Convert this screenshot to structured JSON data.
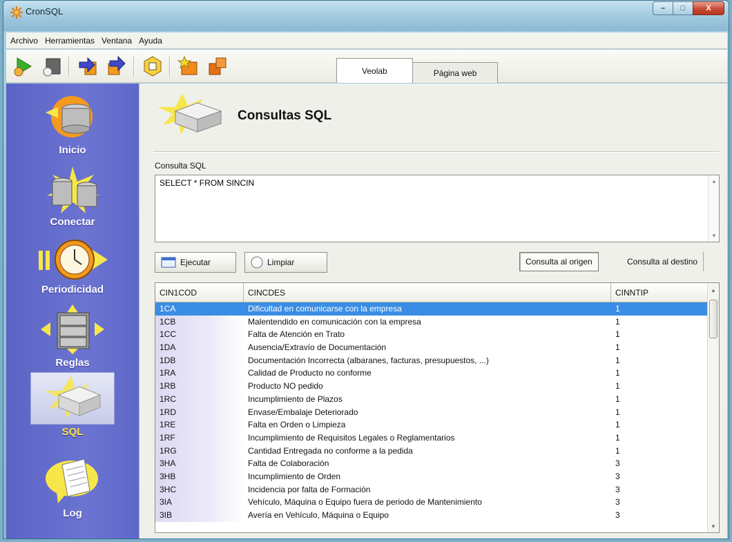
{
  "window": {
    "title": "CronSQL",
    "minimize": "–",
    "maximize": "□",
    "close": "X"
  },
  "menu": [
    "Archivo",
    "Herramientas",
    "Ventana",
    "Ayuda"
  ],
  "tabs": [
    {
      "label": "Veolab",
      "active": true
    },
    {
      "label": "Página web",
      "active": false
    }
  ],
  "sidebar": {
    "items": [
      {
        "label": "Inicio",
        "icon": "database-start-icon"
      },
      {
        "label": "Conectar",
        "icon": "database-connect-icon"
      },
      {
        "label": "Periodicidad",
        "icon": "clock-icon"
      },
      {
        "label": "Reglas",
        "icon": "filing-cabinet-icon"
      },
      {
        "label": "SQL",
        "icon": "sql-block-icon",
        "active": true
      },
      {
        "label": "Log",
        "icon": "log-document-icon"
      }
    ]
  },
  "page": {
    "title": "Consultas SQL",
    "query_label": "Consulta SQL",
    "query_value": "SELECT * FROM SINCIN"
  },
  "actions": {
    "execute": "Ejecutar",
    "clear": "Limpiar",
    "origin": "Consulta al origen",
    "destination": "Consulta al destino"
  },
  "grid": {
    "columns": [
      "CIN1COD",
      "CINCDES",
      "CINNTIP"
    ],
    "rows": [
      [
        "1CA",
        "Dificultad en comunicarse con la empresa",
        "1"
      ],
      [
        "1CB",
        "Malentendido en comunicación con la empresa",
        "1"
      ],
      [
        "1CC",
        "Falta de Atención en Trato",
        "1"
      ],
      [
        "1DA",
        "Ausencia/Extravío de Documentación",
        "1"
      ],
      [
        "1DB",
        "Documentación Incorrecta (albaranes, facturas, presupuestos, ...)",
        "1"
      ],
      [
        "1RA",
        "Calidad de Producto no conforme",
        "1"
      ],
      [
        "1RB",
        "Producto NO pedido",
        "1"
      ],
      [
        "1RC",
        "Incumplimiento de Plazos",
        "1"
      ],
      [
        "1RD",
        "Envase/Embalaje Deteriorado",
        "1"
      ],
      [
        "1RE",
        "Falta en Orden o Limpieza",
        "1"
      ],
      [
        "1RF",
        "Incumplimiento de Requisitos Legales o Reglamentarios",
        "1"
      ],
      [
        "1RG",
        "Cantidad Entregada no conforme a la pedida",
        "1"
      ],
      [
        "3HA",
        "Falta de Colaboración",
        "3"
      ],
      [
        "3HB",
        "Incumplimiento de Orden",
        "3"
      ],
      [
        "3HC",
        "Incidencia por falta de Formación",
        "3"
      ],
      [
        "3IA",
        "Vehículo, Máquina o Equipo fuera de periodo de Mantenimiento",
        "3"
      ],
      [
        "3IB",
        "Avería en Vehículo, Máquina o Equipo",
        "3"
      ]
    ],
    "selected_row": 0
  }
}
